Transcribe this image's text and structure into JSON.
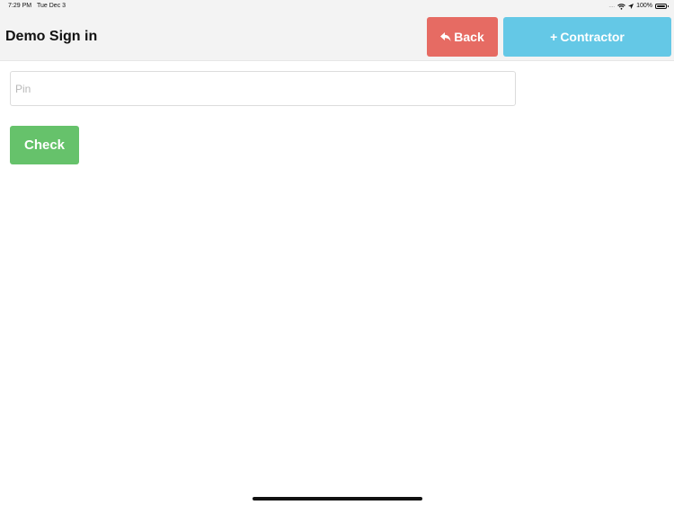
{
  "status_bar": {
    "time": "7:29 PM",
    "date": "Tue Dec 3",
    "signal": "....",
    "battery_percent": "100%",
    "icons": [
      "wifi-icon",
      "location-arrow-icon",
      "battery-icon"
    ]
  },
  "header": {
    "title": "Demo Sign in",
    "back_button": {
      "label": "Back",
      "icon": "reply-arrow-icon",
      "color": "#e66b63"
    },
    "contractor_button": {
      "label": "Contractor",
      "icon": "plus-icon",
      "color": "#64c8e6"
    }
  },
  "form": {
    "pin_input": {
      "placeholder": "Pin",
      "value": ""
    },
    "check_button": {
      "label": "Check",
      "color": "#66c26b"
    }
  }
}
